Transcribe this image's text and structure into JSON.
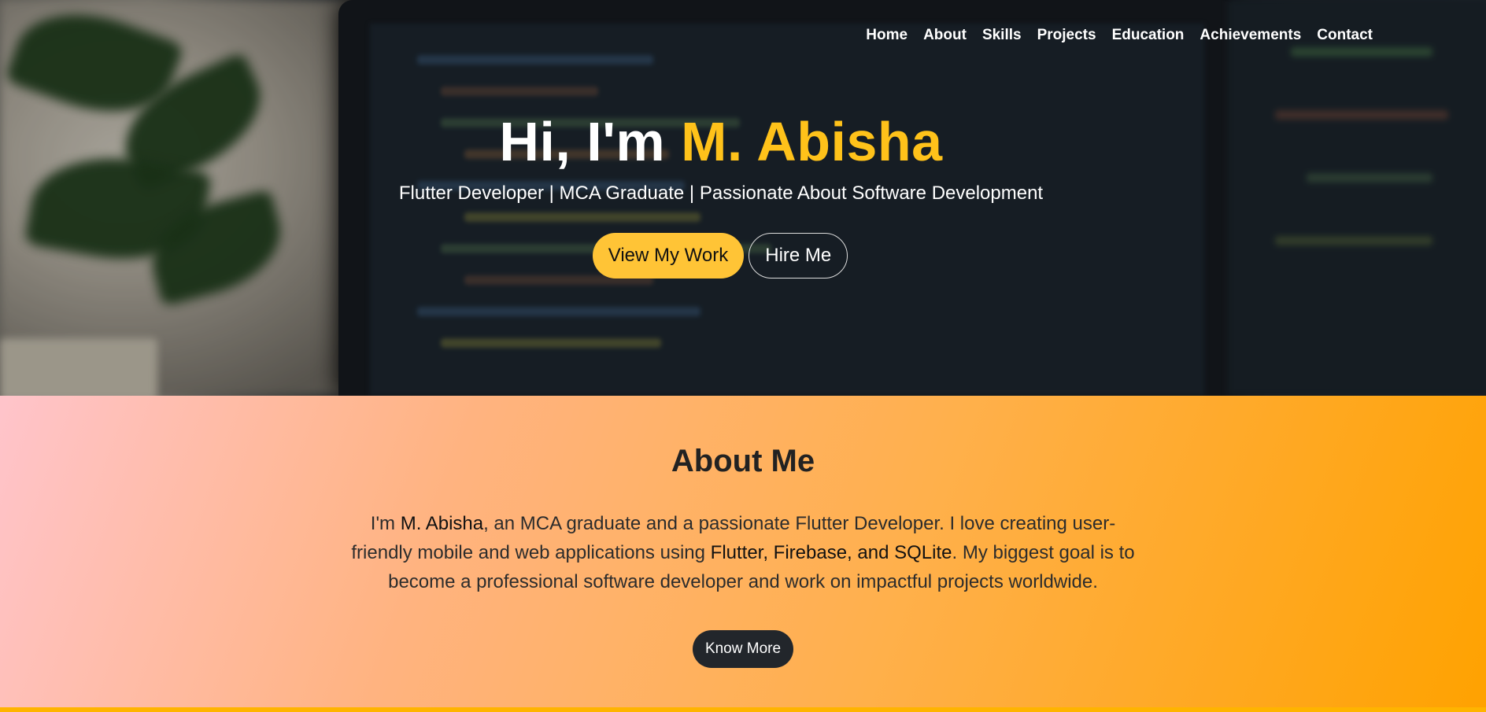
{
  "nav": {
    "items": [
      "Home",
      "About",
      "Skills",
      "Projects",
      "Education",
      "Achievements",
      "Contact"
    ]
  },
  "hero": {
    "greeting": "Hi, I'm ",
    "name": "M. Abisha",
    "subtitle": "Flutter Developer | MCA Graduate | Passionate About Software Development",
    "primary_button": "View My Work",
    "secondary_button": "Hire Me"
  },
  "about": {
    "heading": "About Me",
    "text_1": "I'm ",
    "name": "M. Abisha",
    "text_2": ", an MCA graduate and a passionate Flutter Developer. I love creating user-friendly mobile and web applications using ",
    "tech": "Flutter, Firebase, and SQLite",
    "text_3": ". My biggest goal is to become a professional software developer and work on impactful projects worldwide.",
    "button": "Know More"
  },
  "colors": {
    "accent": "#ffc21a",
    "dark_button": "#22262b",
    "gradient_start": "#ffc4cb",
    "gradient_end": "#ffa200"
  }
}
